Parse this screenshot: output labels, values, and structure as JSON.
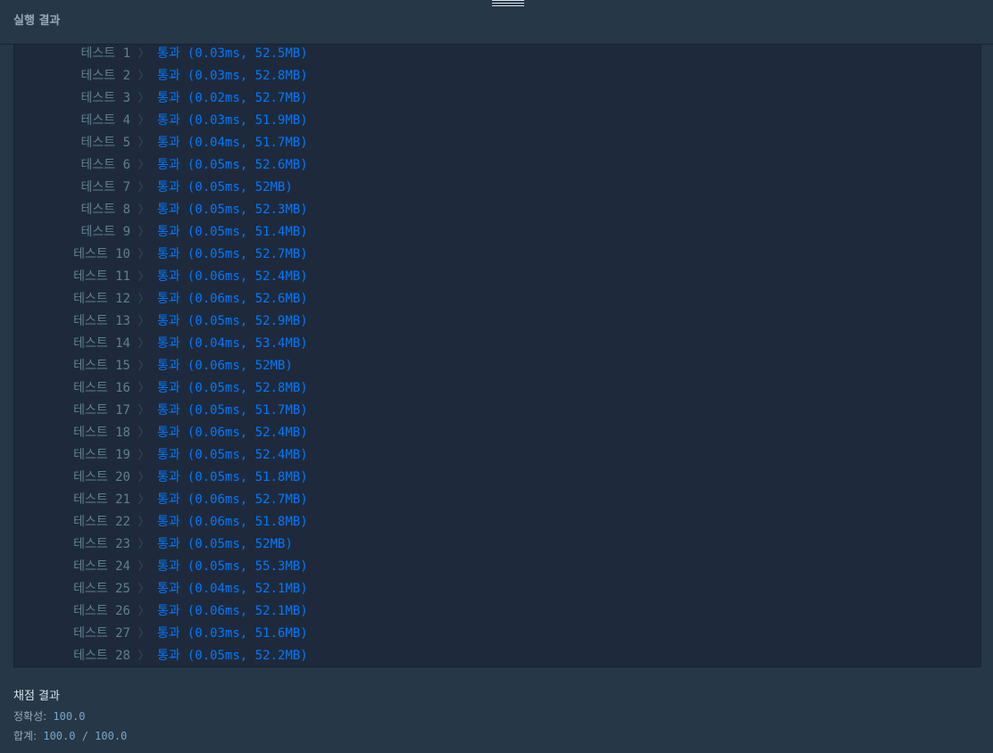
{
  "header": {
    "title": "실행 결과"
  },
  "tests": [
    {
      "label": "테스트 1",
      "status": "통과",
      "detail": "(0.03ms, 52.5MB)"
    },
    {
      "label": "테스트 2",
      "status": "통과",
      "detail": "(0.03ms, 52.8MB)"
    },
    {
      "label": "테스트 3",
      "status": "통과",
      "detail": "(0.02ms, 52.7MB)"
    },
    {
      "label": "테스트 4",
      "status": "통과",
      "detail": "(0.03ms, 51.9MB)"
    },
    {
      "label": "테스트 5",
      "status": "통과",
      "detail": "(0.04ms, 51.7MB)"
    },
    {
      "label": "테스트 6",
      "status": "통과",
      "detail": "(0.05ms, 52.6MB)"
    },
    {
      "label": "테스트 7",
      "status": "통과",
      "detail": "(0.05ms, 52MB)"
    },
    {
      "label": "테스트 8",
      "status": "통과",
      "detail": "(0.05ms, 52.3MB)"
    },
    {
      "label": "테스트 9",
      "status": "통과",
      "detail": "(0.05ms, 51.4MB)"
    },
    {
      "label": "테스트 10",
      "status": "통과",
      "detail": "(0.05ms, 52.7MB)"
    },
    {
      "label": "테스트 11",
      "status": "통과",
      "detail": "(0.06ms, 52.4MB)"
    },
    {
      "label": "테스트 12",
      "status": "통과",
      "detail": "(0.06ms, 52.6MB)"
    },
    {
      "label": "테스트 13",
      "status": "통과",
      "detail": "(0.05ms, 52.9MB)"
    },
    {
      "label": "테스트 14",
      "status": "통과",
      "detail": "(0.04ms, 53.4MB)"
    },
    {
      "label": "테스트 15",
      "status": "통과",
      "detail": "(0.06ms, 52MB)"
    },
    {
      "label": "테스트 16",
      "status": "통과",
      "detail": "(0.05ms, 52.8MB)"
    },
    {
      "label": "테스트 17",
      "status": "통과",
      "detail": "(0.05ms, 51.7MB)"
    },
    {
      "label": "테스트 18",
      "status": "통과",
      "detail": "(0.06ms, 52.4MB)"
    },
    {
      "label": "테스트 19",
      "status": "통과",
      "detail": "(0.05ms, 52.4MB)"
    },
    {
      "label": "테스트 20",
      "status": "통과",
      "detail": "(0.05ms, 51.8MB)"
    },
    {
      "label": "테스트 21",
      "status": "통과",
      "detail": "(0.06ms, 52.7MB)"
    },
    {
      "label": "테스트 22",
      "status": "통과",
      "detail": "(0.06ms, 51.8MB)"
    },
    {
      "label": "테스트 23",
      "status": "통과",
      "detail": "(0.05ms, 52MB)"
    },
    {
      "label": "테스트 24",
      "status": "통과",
      "detail": "(0.05ms, 55.3MB)"
    },
    {
      "label": "테스트 25",
      "status": "통과",
      "detail": "(0.04ms, 52.1MB)"
    },
    {
      "label": "테스트 26",
      "status": "통과",
      "detail": "(0.06ms, 52.1MB)"
    },
    {
      "label": "테스트 27",
      "status": "통과",
      "detail": "(0.03ms, 51.6MB)"
    },
    {
      "label": "테스트 28",
      "status": "통과",
      "detail": "(0.05ms, 52.2MB)"
    }
  ],
  "separator_glyph": "〉",
  "grading": {
    "title": "채점 결과",
    "accuracy_label": "정확성:",
    "accuracy_value": "100.0",
    "total_label": "합계:",
    "total_value": "100.0 / 100.0"
  },
  "colors": {
    "background": "#263747",
    "panel": "#1e2a3c",
    "pass": "#0078ff",
    "muted": "#5f7f90"
  }
}
